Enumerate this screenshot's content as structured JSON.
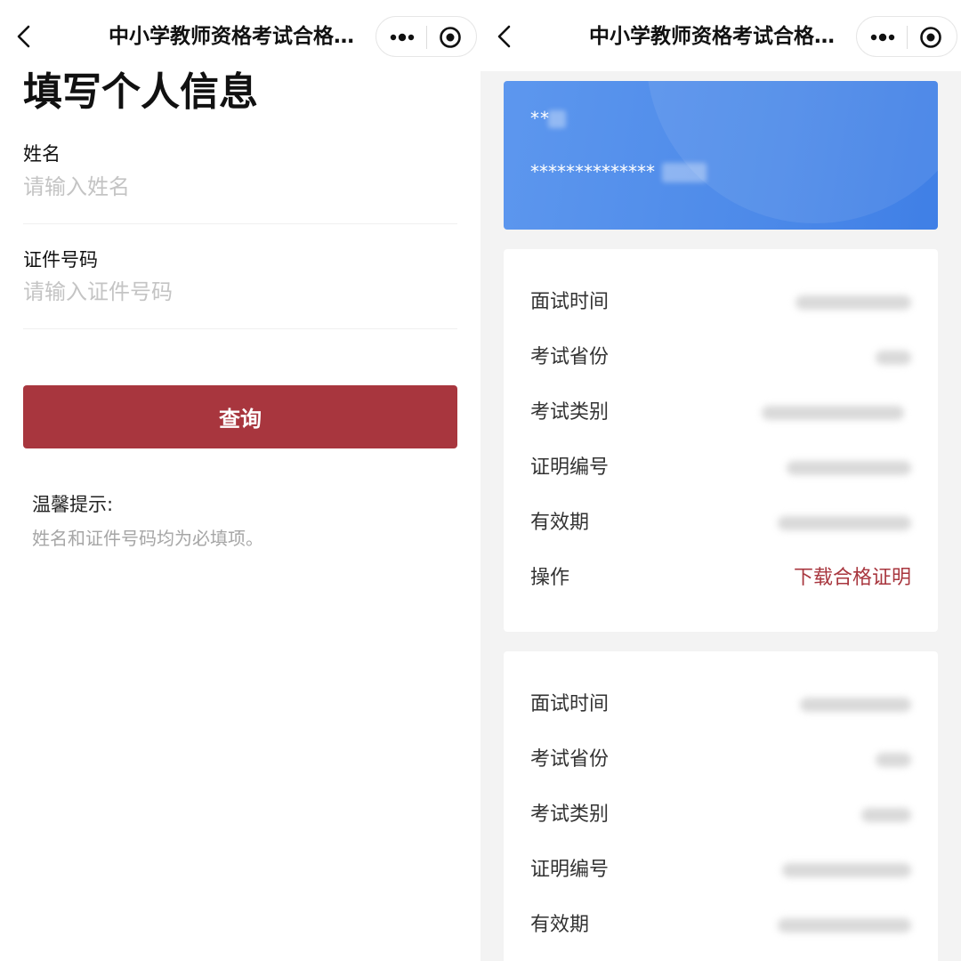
{
  "left": {
    "nav_title": "中小学教师资格考试合格…",
    "page_title": "填写个人信息",
    "name_label": "姓名",
    "name_placeholder": "请输入姓名",
    "id_label": "证件号码",
    "id_placeholder": "请输入证件号码",
    "query_button": "查询",
    "tip_title": "温馨提示:",
    "tip_text": "姓名和证件号码均为必填项。"
  },
  "right": {
    "nav_title": "中小学教师资格考试合格…",
    "card_name": "**",
    "card_id": "**************",
    "records": [
      {
        "rows": [
          {
            "label": "面试时间"
          },
          {
            "label": "考试省份"
          },
          {
            "label": "考试类别"
          },
          {
            "label": "证明编号"
          },
          {
            "label": "有效期"
          },
          {
            "label": "操作",
            "value": "下载合格证明"
          }
        ]
      },
      {
        "rows": [
          {
            "label": "面试时间"
          },
          {
            "label": "考试省份"
          },
          {
            "label": "考试类别"
          },
          {
            "label": "证明编号"
          },
          {
            "label": "有效期"
          }
        ]
      }
    ]
  },
  "colors": {
    "accent": "#a8363e",
    "card_blue": "#4d8ae9",
    "background_gray": "#f3f3f3"
  },
  "icons": [
    "back-icon",
    "more-icon",
    "close-icon"
  ]
}
